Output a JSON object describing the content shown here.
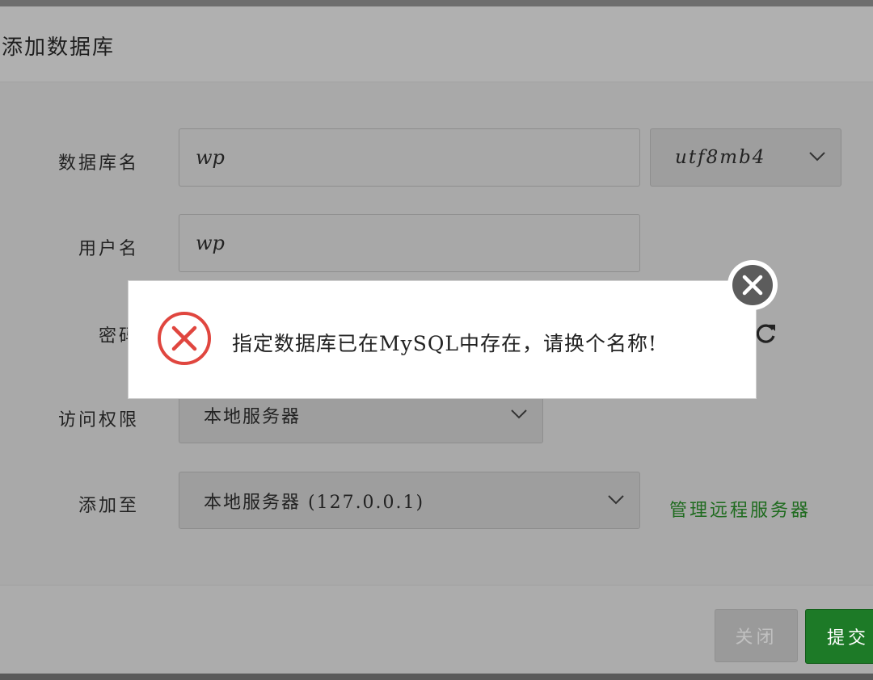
{
  "dialog": {
    "title": "添加数据库",
    "form": {
      "db_name": {
        "label": "数据库名",
        "value": "wp"
      },
      "charset": {
        "value": "utf8mb4"
      },
      "username": {
        "label": "用户名",
        "value": "wp"
      },
      "password": {
        "label": "密码"
      },
      "access": {
        "label": "访问权限",
        "value": "本地服务器"
      },
      "add_to": {
        "label": "添加至",
        "value": "本地服务器 (127.0.0.1)"
      },
      "manage_remote_link": "管理远程服务器"
    },
    "footer": {
      "close_label": "关闭",
      "submit_label": "提交"
    }
  },
  "message": {
    "text": "指定数据库已在MySQL中存在，请换个名称!",
    "icon": "error-circle-icon",
    "icon_color": "#e0463f"
  },
  "colors": {
    "link_green": "#1f6b1f",
    "submit_green": "#1d7a27"
  }
}
